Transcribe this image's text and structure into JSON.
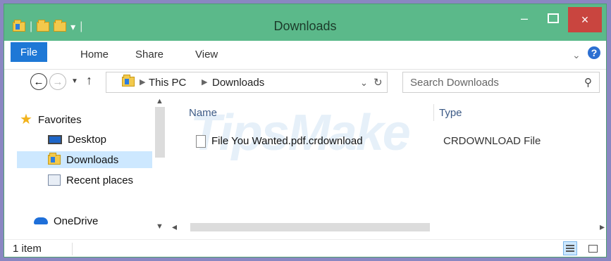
{
  "window": {
    "title": "Downloads"
  },
  "title_buttons": {
    "minimize": "–",
    "close": "×"
  },
  "ribbon": {
    "tabs": [
      {
        "label": "File"
      },
      {
        "label": "Home"
      },
      {
        "label": "Share"
      },
      {
        "label": "View"
      }
    ],
    "help": "?"
  },
  "address": {
    "crumbs": [
      "This PC",
      "Downloads"
    ]
  },
  "search": {
    "placeholder": "Search Downloads"
  },
  "sidebar": {
    "items": [
      {
        "label": "Favorites",
        "icon": "star-icon"
      },
      {
        "label": "Desktop",
        "icon": "desktop-icon"
      },
      {
        "label": "Downloads",
        "icon": "downloads-folder-icon",
        "selected": true
      },
      {
        "label": "Recent places",
        "icon": "recent-places-icon"
      },
      {
        "label": "OneDrive",
        "icon": "onedrive-icon"
      }
    ]
  },
  "columns": {
    "name": "Name",
    "type": "Type"
  },
  "files": [
    {
      "name": "File You Wanted.pdf.crdownload",
      "type": "CRDOWNLOAD File"
    }
  ],
  "watermark": "TipsMake",
  "status": {
    "count": "1 item"
  },
  "colors": {
    "titlebar": "#5bb98a",
    "accent": "#1e78d6",
    "close": "#c9453f",
    "selection": "#cde8ff"
  }
}
